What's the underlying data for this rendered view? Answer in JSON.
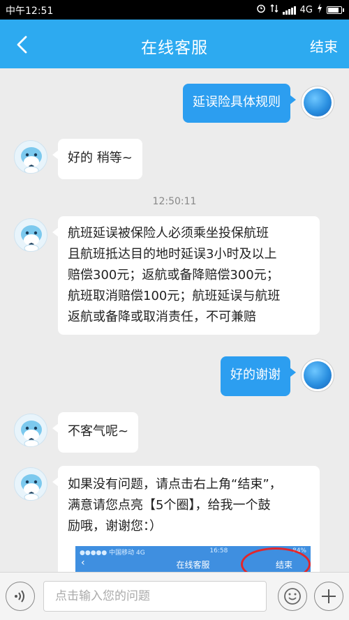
{
  "status_bar": {
    "time": "中午12:51",
    "network": "4G"
  },
  "header": {
    "title": "在线客服",
    "end_label": "结束"
  },
  "messages": [
    {
      "from": "user",
      "text": "延误险具体规则"
    },
    {
      "from": "bot",
      "text": "好的 稍等~"
    },
    {
      "from": "bot",
      "lines": [
        "航班延误被保险人必须乘坐投保航班",
        "且航班抵达目的地时延误3小时及以上",
        "赔偿300元；返航或备降赔偿300元；",
        "航班取消赔偿100元；航班延误与航班",
        "返航或备降或取消责任，不可兼赔"
      ]
    },
    {
      "from": "user",
      "text": "好的谢谢"
    },
    {
      "from": "bot",
      "text": "不客气呢~"
    },
    {
      "from": "bot",
      "lines": [
        "如果没有问题，请点击右上角“结束”，",
        "满意请您点亮【5个圈】，给我一个鼓",
        "励哦，谢谢您：）"
      ]
    }
  ],
  "timestamp": "12:50:11",
  "embedded_screenshot": {
    "carrier": "●●●●● 中国移动  4G",
    "time": "16:58",
    "battery": "84%",
    "title": "在线客服",
    "end_label": "结束"
  },
  "input": {
    "placeholder": "点击输入您的问题"
  },
  "colors": {
    "header": "#2daaf0",
    "user_bubble": "#2c9ef0",
    "background": "#ececec",
    "highlight_circle": "#e2262b"
  }
}
